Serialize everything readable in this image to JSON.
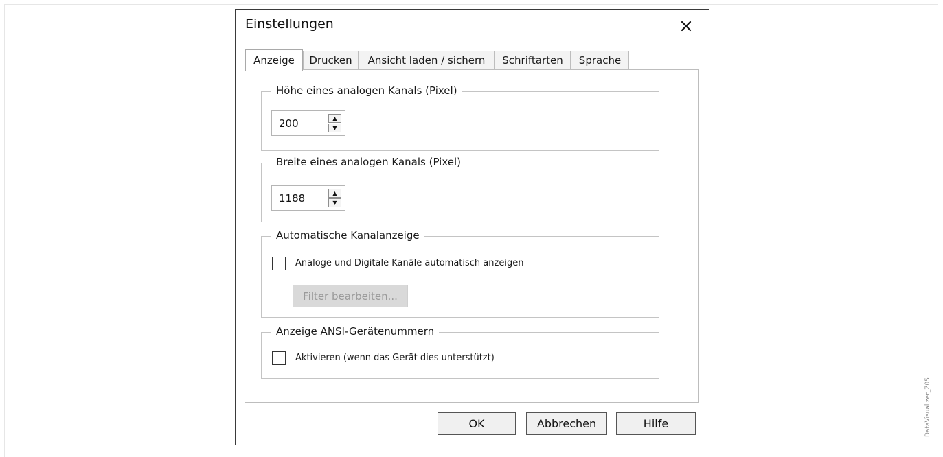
{
  "dialog": {
    "title": "Einstellungen",
    "close_icon": "close-icon"
  },
  "tabs": [
    {
      "label": "Anzeige",
      "active": true
    },
    {
      "label": "Drucken",
      "active": false
    },
    {
      "label": "Ansicht laden / sichern",
      "active": false
    },
    {
      "label": "Schriftarten",
      "active": false
    },
    {
      "label": "Sprache",
      "active": false
    }
  ],
  "groups": {
    "height": {
      "legend": "Höhe eines analogen Kanals (Pixel)",
      "value": "200"
    },
    "width": {
      "legend": "Breite eines analogen Kanals (Pixel)",
      "value": "1188"
    },
    "auto": {
      "legend": "Automatische Kanalanzeige",
      "checkbox_label": "Analoge und Digitale Kanäle automatisch anzeigen",
      "checked": false,
      "filter_button": "Filter bearbeiten..."
    },
    "ansi": {
      "legend": "Anzeige ANSI-Gerätenummern",
      "checkbox_label": "Aktivieren (wenn das Gerät dies unterstützt)",
      "checked": false
    }
  },
  "buttons": {
    "ok": "OK",
    "cancel": "Abbrechen",
    "help": "Hilfe"
  },
  "side_caption": "DataVisualizer_Z05"
}
